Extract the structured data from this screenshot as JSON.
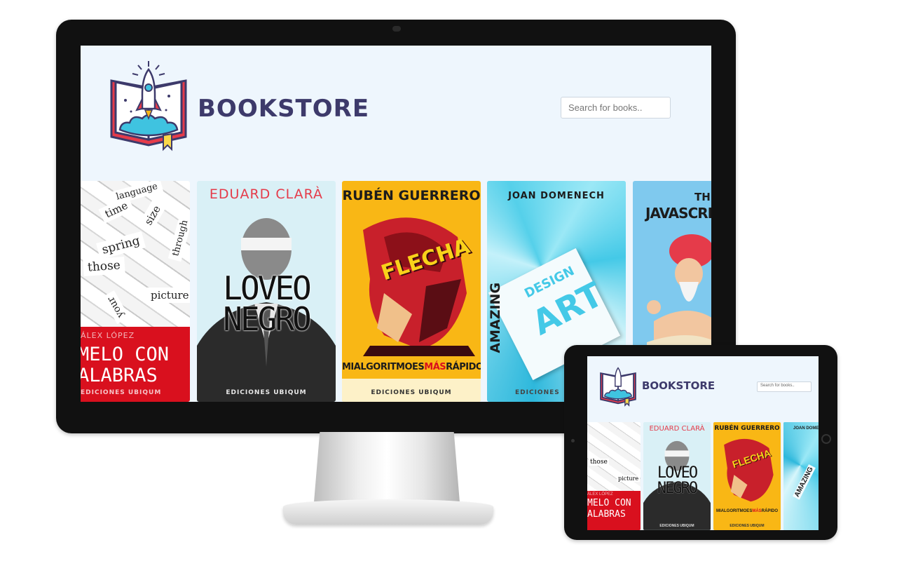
{
  "site": {
    "brand": "BOOKSTORE",
    "search_placeholder": "Search for books.."
  },
  "books": [
    {
      "author": "ÁLEX LÓPEZ",
      "title_lines": [
        "MELO CON",
        "ALABRAS"
      ],
      "publisher": "EDICIONES UBIQUM",
      "cover_words": [
        "spring",
        "those",
        "picture",
        "time",
        "size",
        "through",
        "your",
        "language"
      ]
    },
    {
      "author": "EDUARD CLARÀ",
      "title_lines": [
        "LOVEO",
        "NEGRO"
      ],
      "publisher": "EDICIONES UBIQUM"
    },
    {
      "author": "RUBÉN GUERRERO",
      "cover_word": "FLECHA",
      "title_parts": [
        "MIALGORITMOES",
        "MÁS",
        "RÁPIDO"
      ],
      "publisher": "EDICIONES UBIQUM"
    },
    {
      "author": "JOAN DOMENECH",
      "title_lines": [
        "AMAZING",
        "DESIGN",
        "ART"
      ],
      "publisher": "EDICIONES"
    },
    {
      "title_lines": [
        "THE",
        "JAVASCRIP"
      ]
    }
  ],
  "colors": {
    "brand": "#3d3a6b",
    "page_bg": "#eef6fd",
    "accent_red": "#e53b4a",
    "accent_yellow": "#f9b715",
    "accent_cyan": "#6fd8ee"
  }
}
